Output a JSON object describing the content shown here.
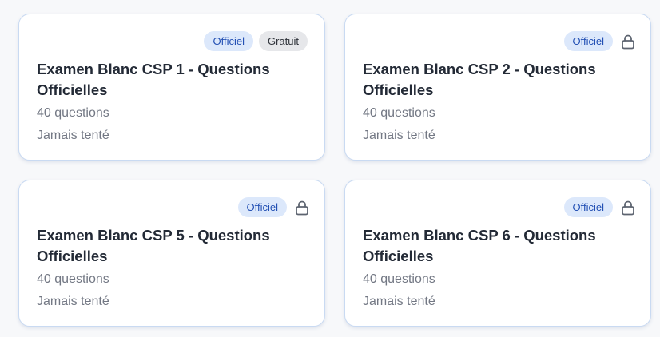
{
  "cards": [
    {
      "title": "Examen Blanc CSP 1 - Questions Officielles",
      "question_count": "40 questions",
      "status": "Jamais tenté",
      "badge_official": "Officiel",
      "badge_free": "Gratuit",
      "locked": false
    },
    {
      "title": "Examen Blanc CSP 2 - Questions Officielles",
      "question_count": "40 questions",
      "status": "Jamais tenté",
      "badge_official": "Officiel",
      "locked": true,
      "icon": "lock-icon"
    },
    {
      "title": "Examen Blanc CSP 5 - Questions Officielles",
      "question_count": "40 questions",
      "status": "Jamais tenté",
      "badge_official": "Officiel",
      "locked": true,
      "icon": "lock-icon"
    },
    {
      "title": "Examen Blanc CSP 6 - Questions Officielles",
      "question_count": "40 questions",
      "status": "Jamais tenté",
      "badge_official": "Officiel",
      "locked": true,
      "icon": "lock-icon"
    }
  ],
  "colors": {
    "accent_badge_bg": "#dce8fb",
    "accent_badge_text": "#2350b4",
    "free_badge_bg": "#e6e7ea",
    "card_border": "#c9daf2",
    "title_text": "#232a36",
    "meta_text": "#737884"
  }
}
